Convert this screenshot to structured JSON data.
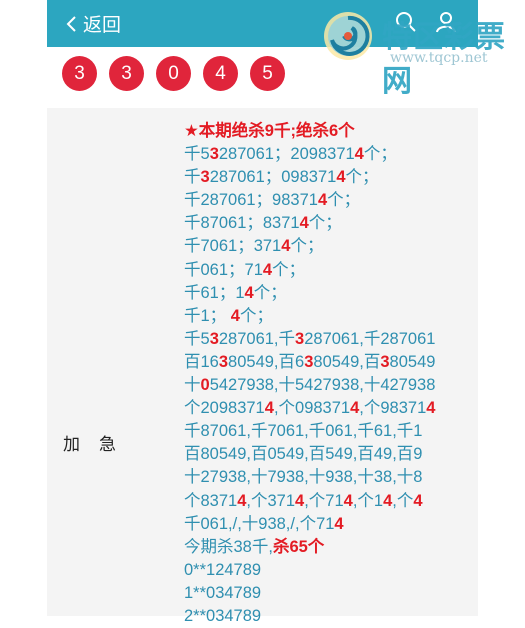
{
  "header": {
    "back_label": "返回"
  },
  "brand": {
    "name": "特区彩票网",
    "url": "www.tqcp.net"
  },
  "draw_numbers": [
    "3",
    "3",
    "0",
    "4",
    "5"
  ],
  "section": {
    "label_a": "加",
    "label_b": "急"
  },
  "colors": {
    "header_bg": "#2ca6c0",
    "ball": "#e0253b",
    "text": "#2f8fb0",
    "highlight": "#e31b23",
    "panel_bg": "#f4f4f4"
  },
  "content_lines": [
    {
      "h": true,
      "parts": [
        {
          "t": "★本期绝杀9千;绝杀6个",
          "r": 1
        }
      ]
    },
    {
      "parts": [
        {
          "t": "千5"
        },
        {
          "t": "3",
          "r": 1
        },
        {
          "t": "287061；2098371"
        },
        {
          "t": "4",
          "r": 1
        },
        {
          "t": "个；"
        }
      ]
    },
    {
      "parts": [
        {
          "t": "千"
        },
        {
          "t": "3",
          "r": 1
        },
        {
          "t": "287061；098371"
        },
        {
          "t": "4",
          "r": 1
        },
        {
          "t": "个；"
        }
      ]
    },
    {
      "parts": [
        {
          "t": "千287061；98371"
        },
        {
          "t": "4",
          "r": 1
        },
        {
          "t": "个；"
        }
      ]
    },
    {
      "parts": [
        {
          "t": "千87061；8371"
        },
        {
          "t": "4",
          "r": 1
        },
        {
          "t": "个；"
        }
      ]
    },
    {
      "parts": [
        {
          "t": "千7061；371"
        },
        {
          "t": "4",
          "r": 1
        },
        {
          "t": "个；"
        }
      ]
    },
    {
      "parts": [
        {
          "t": "千061；71"
        },
        {
          "t": "4",
          "r": 1
        },
        {
          "t": "个；"
        }
      ]
    },
    {
      "parts": [
        {
          "t": "千61；1"
        },
        {
          "t": "4",
          "r": 1
        },
        {
          "t": "个；"
        }
      ]
    },
    {
      "parts": [
        {
          "t": "千1；  "
        },
        {
          "t": "4",
          "r": 1
        },
        {
          "t": "个；"
        }
      ]
    },
    {
      "parts": [
        {
          "t": "千5"
        },
        {
          "t": "3",
          "r": 1
        },
        {
          "t": "287061,千"
        },
        {
          "t": "3",
          "r": 1
        },
        {
          "t": "287061,千287061"
        }
      ]
    },
    {
      "parts": [
        {
          "t": "百16"
        },
        {
          "t": "3",
          "r": 1
        },
        {
          "t": "80549,百6"
        },
        {
          "t": "3",
          "r": 1
        },
        {
          "t": "80549,百"
        },
        {
          "t": "3",
          "r": 1
        },
        {
          "t": "80549"
        }
      ]
    },
    {
      "parts": [
        {
          "t": "十"
        },
        {
          "t": "0",
          "r": 1
        },
        {
          "t": "5427938,十5427938,十427938"
        }
      ]
    },
    {
      "parts": [
        {
          "t": "个2098371"
        },
        {
          "t": "4",
          "r": 1
        },
        {
          "t": ",个098371"
        },
        {
          "t": "4",
          "r": 1
        },
        {
          "t": ",个98371"
        },
        {
          "t": "4",
          "r": 1
        }
      ]
    },
    {
      "parts": [
        {
          "t": "千87061,千7061,千061,千61,千1"
        }
      ]
    },
    {
      "parts": [
        {
          "t": "百80549,百0549,百549,百49,百9"
        }
      ]
    },
    {
      "parts": [
        {
          "t": "十27938,十7938,十938,十38,十8"
        }
      ]
    },
    {
      "parts": [
        {
          "t": "个8371"
        },
        {
          "t": "4",
          "r": 1
        },
        {
          "t": ",个371"
        },
        {
          "t": "4",
          "r": 1
        },
        {
          "t": ",个71"
        },
        {
          "t": "4",
          "r": 1
        },
        {
          "t": ",个1"
        },
        {
          "t": "4",
          "r": 1
        },
        {
          "t": ",个"
        },
        {
          "t": "4",
          "r": 1
        }
      ]
    },
    {
      "parts": [
        {
          "t": "千061,/,十938,/,个71"
        },
        {
          "t": "4",
          "r": 1
        }
      ]
    },
    {
      "parts": [
        {
          "t": "今期杀38千,"
        },
        {
          "t": "杀65个",
          "r": 1
        }
      ]
    },
    {
      "parts": [
        {
          "t": "0**124789"
        }
      ]
    },
    {
      "parts": [
        {
          "t": "1**034789"
        }
      ]
    },
    {
      "parts": [
        {
          "t": "2**034789"
        }
      ]
    }
  ]
}
